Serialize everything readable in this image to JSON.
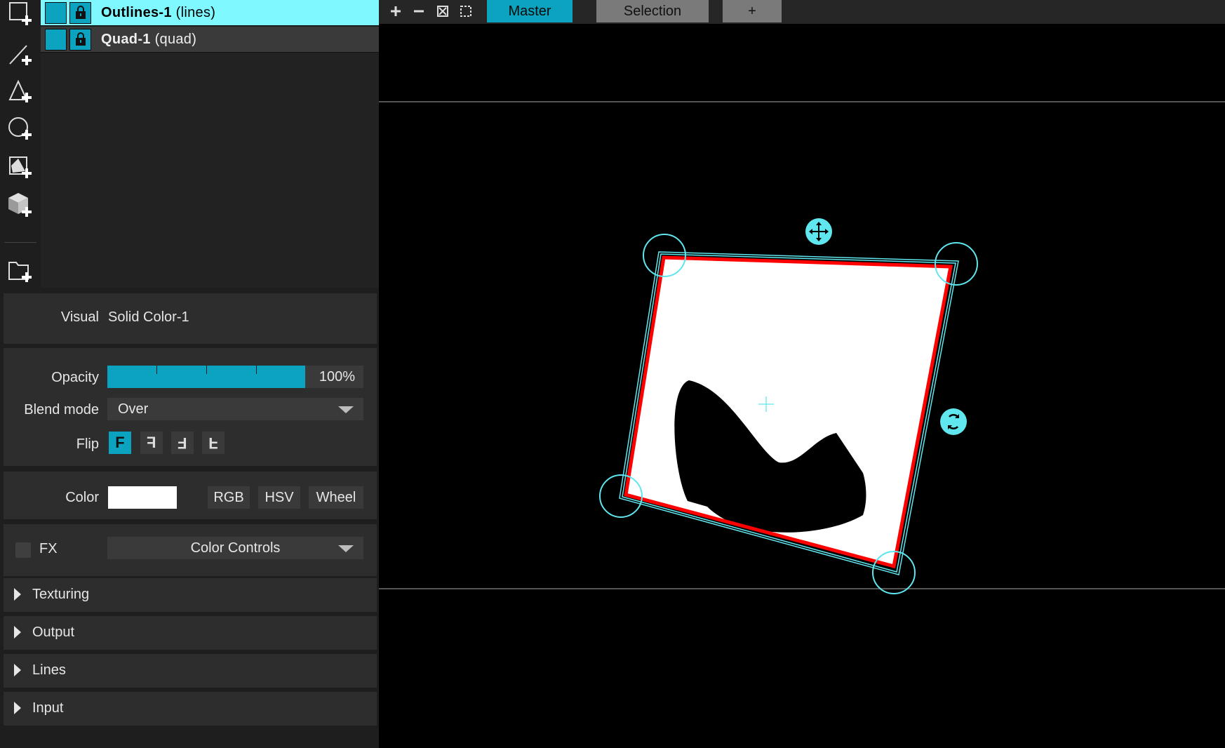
{
  "toolstrip": {
    "tools": [
      {
        "name": "add-rectangle-icon"
      },
      {
        "name": "add-line-icon"
      },
      {
        "name": "add-triangle-icon"
      },
      {
        "name": "add-circle-icon"
      },
      {
        "name": "add-mesh-icon"
      },
      {
        "name": "add-3d-object-icon"
      },
      {
        "name": "import-file-icon"
      }
    ]
  },
  "layers": [
    {
      "name": "Outlines-1",
      "type": "(lines)",
      "selected": true
    },
    {
      "name": "Quad-1",
      "type": "(quad)",
      "selected": false
    }
  ],
  "props": {
    "visual_label": "Visual",
    "visual_value": "Solid Color-1",
    "opacity_label": "Opacity",
    "opacity_value": "100%",
    "opacity_fraction": 1.0,
    "blend_label": "Blend mode",
    "blend_value": "Over",
    "flip_label": "Flip",
    "flip_buttons": [
      "F",
      "Ⅎ",
      "ℲF",
      "Ⅎ"
    ],
    "color_label": "Color",
    "color_value": "#ffffff",
    "color_buttons": [
      "RGB",
      "HSV",
      "Wheel"
    ],
    "fx_label": "FX",
    "fx_value": "Color Controls",
    "sections": [
      "Texturing",
      "Output",
      "Lines",
      "Input"
    ]
  },
  "topbar": {
    "tabs": [
      "Master",
      "Selection",
      "+"
    ],
    "active_tab": "Master"
  },
  "colors": {
    "accent": "#0ba3bf",
    "selection_highlight": "#7ff8ff",
    "outline_red": "#ff0000",
    "handle_cyan": "#5fe6ee"
  }
}
